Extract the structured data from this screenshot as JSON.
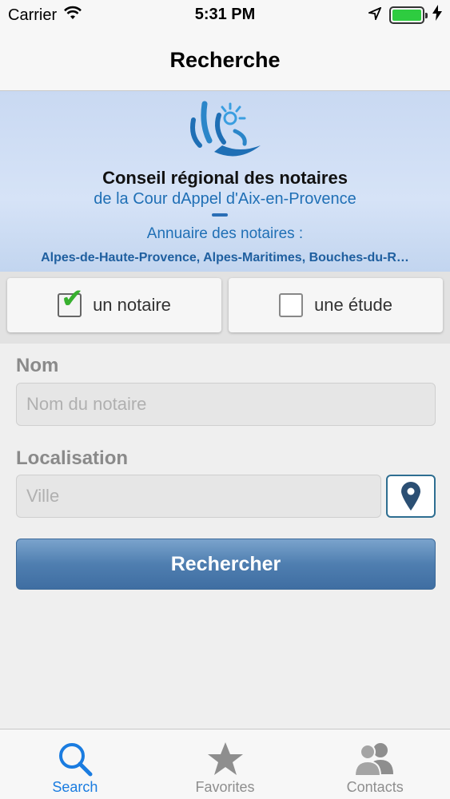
{
  "status_bar": {
    "carrier": "Carrier",
    "time": "5:31 PM"
  },
  "nav": {
    "title": "Recherche"
  },
  "banner": {
    "title": "Conseil régional des notaires",
    "subtitle": "de la Cour dAppel d'Aix-en-Provence",
    "directory": "Annuaire des notaires :",
    "regions": "Alpes-de-Haute-Provence, Alpes-Maritimes, Bouches-du-R…"
  },
  "toggle": {
    "notary_label": "un notaire",
    "notary_checked": true,
    "office_label": "une étude",
    "office_checked": false
  },
  "form": {
    "name_label": "Nom",
    "name_placeholder": "Nom du notaire",
    "location_label": "Localisation",
    "location_placeholder": "Ville",
    "search_label": "Rechercher"
  },
  "tabs": [
    {
      "label": "Search",
      "icon": "search-icon",
      "active": true
    },
    {
      "label": "Favorites",
      "icon": "star-icon",
      "active": false
    },
    {
      "label": "Contacts",
      "icon": "contacts-icon",
      "active": false
    }
  ],
  "colors": {
    "accent": "#1a7ce0",
    "button": "#4f7eb0",
    "check": "#37b02e",
    "battery": "#2ecc40"
  }
}
